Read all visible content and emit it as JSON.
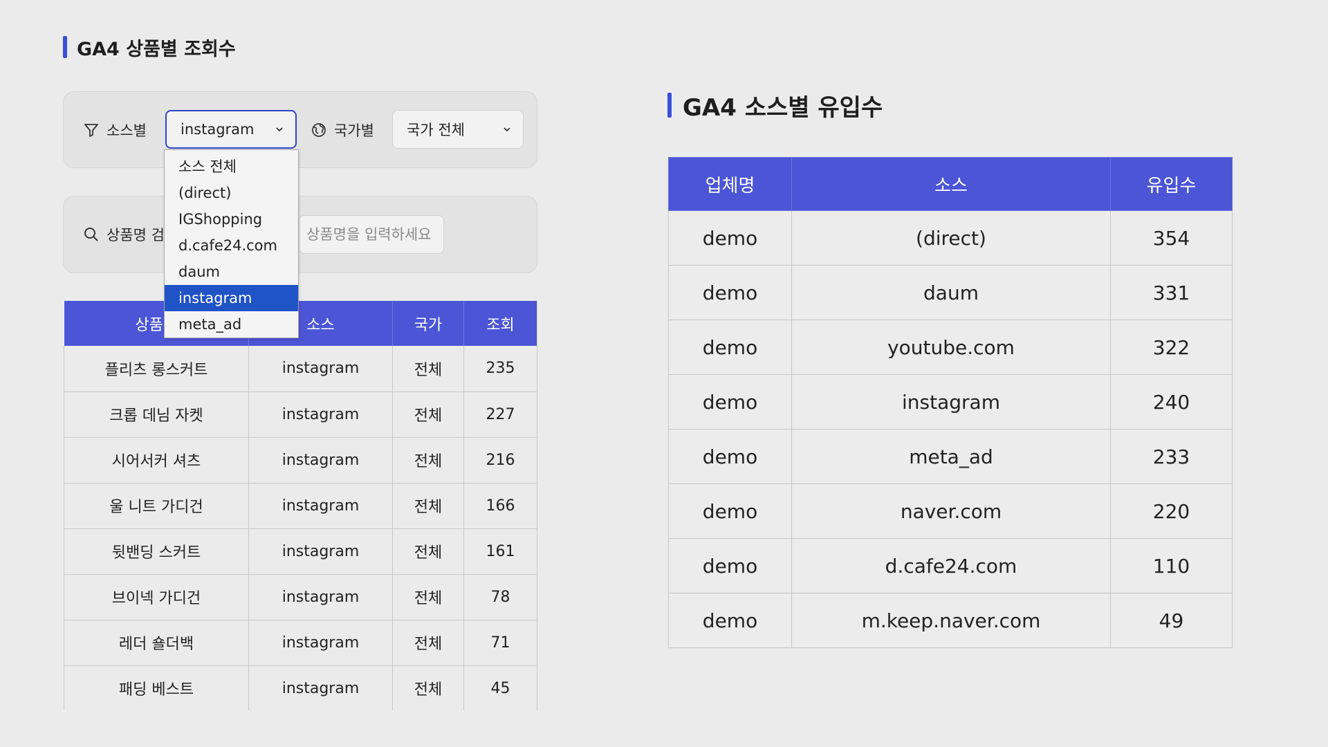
{
  "left_panel": {
    "title": "GA4 상품별 조회수",
    "filters": {
      "source_label": "소스별",
      "source_selected": "instagram",
      "source_options": [
        "소스 전체",
        "(direct)",
        "IGShopping",
        "d.cafe24.com",
        "daum",
        "instagram",
        "meta_ad"
      ],
      "country_label": "국가별",
      "country_selected": "국가 전체"
    },
    "search": {
      "label": "상품명 검색",
      "placeholder": "상품명을 입력하세요"
    },
    "table": {
      "headers": [
        "상품명",
        "소스",
        "국가",
        "조회"
      ],
      "rows": [
        {
          "product": "플리츠 롱스커트",
          "source": "instagram",
          "country": "전체",
          "views": "235"
        },
        {
          "product": "크롭 데님 자켓",
          "source": "instagram",
          "country": "전체",
          "views": "227"
        },
        {
          "product": "시어서커 셔츠",
          "source": "instagram",
          "country": "전체",
          "views": "216"
        },
        {
          "product": "울 니트 가디건",
          "source": "instagram",
          "country": "전체",
          "views": "166"
        },
        {
          "product": "뒷밴딩 스커트",
          "source": "instagram",
          "country": "전체",
          "views": "161"
        },
        {
          "product": "브이넥 가디건",
          "source": "instagram",
          "country": "전체",
          "views": "78"
        },
        {
          "product": "레더 숄더백",
          "source": "instagram",
          "country": "전체",
          "views": "71"
        },
        {
          "product": "패딩 베스트",
          "source": "instagram",
          "country": "전체",
          "views": "45"
        }
      ]
    }
  },
  "right_panel": {
    "title": "GA4 소스별 유입수",
    "table": {
      "headers": [
        "업체명",
        "소스",
        "유입수"
      ],
      "rows": [
        {
          "company": "demo",
          "source": "(direct)",
          "visits": "354"
        },
        {
          "company": "demo",
          "source": "daum",
          "visits": "331"
        },
        {
          "company": "demo",
          "source": "youtube.com",
          "visits": "322"
        },
        {
          "company": "demo",
          "source": "instagram",
          "visits": "240"
        },
        {
          "company": "demo",
          "source": "meta_ad",
          "visits": "233"
        },
        {
          "company": "demo",
          "source": "naver.com",
          "visits": "220"
        },
        {
          "company": "demo",
          "source": "d.cafe24.com",
          "visits": "110"
        },
        {
          "company": "demo",
          "source": "m.keep.naver.com",
          "visits": "49"
        }
      ]
    }
  },
  "colors": {
    "accent": "#4b55d6",
    "title_bar": "#3b4fd8",
    "dropdown_highlight": "#1f53c6",
    "background": "#ebebeb"
  },
  "icons": {
    "source_filter": "filter-funnel-icon",
    "country_filter": "globe-icon",
    "search": "search-icon",
    "dropdown": "chevron-down-icon"
  }
}
